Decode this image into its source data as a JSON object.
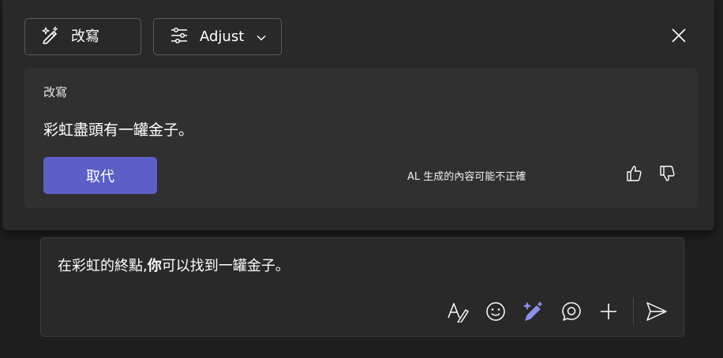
{
  "toolbar": {
    "rewrite_label": "改寫",
    "adjust_label": "Adjust"
  },
  "card": {
    "heading": "改寫",
    "rewritten_text": "彩虹盡頭有一罐金子。",
    "replace_label": "取代",
    "disclaimer": "AL 生成的內容可能不正確"
  },
  "compose": {
    "text_before": "在彩虹的終點,",
    "text_bold": "你",
    "text_after": "可以找到一罐金子。"
  },
  "icons": {
    "rewrite": "sparkle-pen-icon",
    "adjust": "sliders-icon",
    "close": "close-icon",
    "thumbs_up": "thumbs-up-icon",
    "thumbs_down": "thumbs-down-icon",
    "format": "format-text-icon",
    "emoji": "emoji-icon",
    "copilot": "copilot-pen-icon",
    "loop": "loop-icon",
    "add": "plus-icon",
    "send": "send-icon"
  },
  "colors": {
    "accent": "#5b5fc7",
    "copilot_icon": "#8b8fe8",
    "background": "#1f1f1f",
    "panel": "#292929",
    "card": "#303030"
  }
}
